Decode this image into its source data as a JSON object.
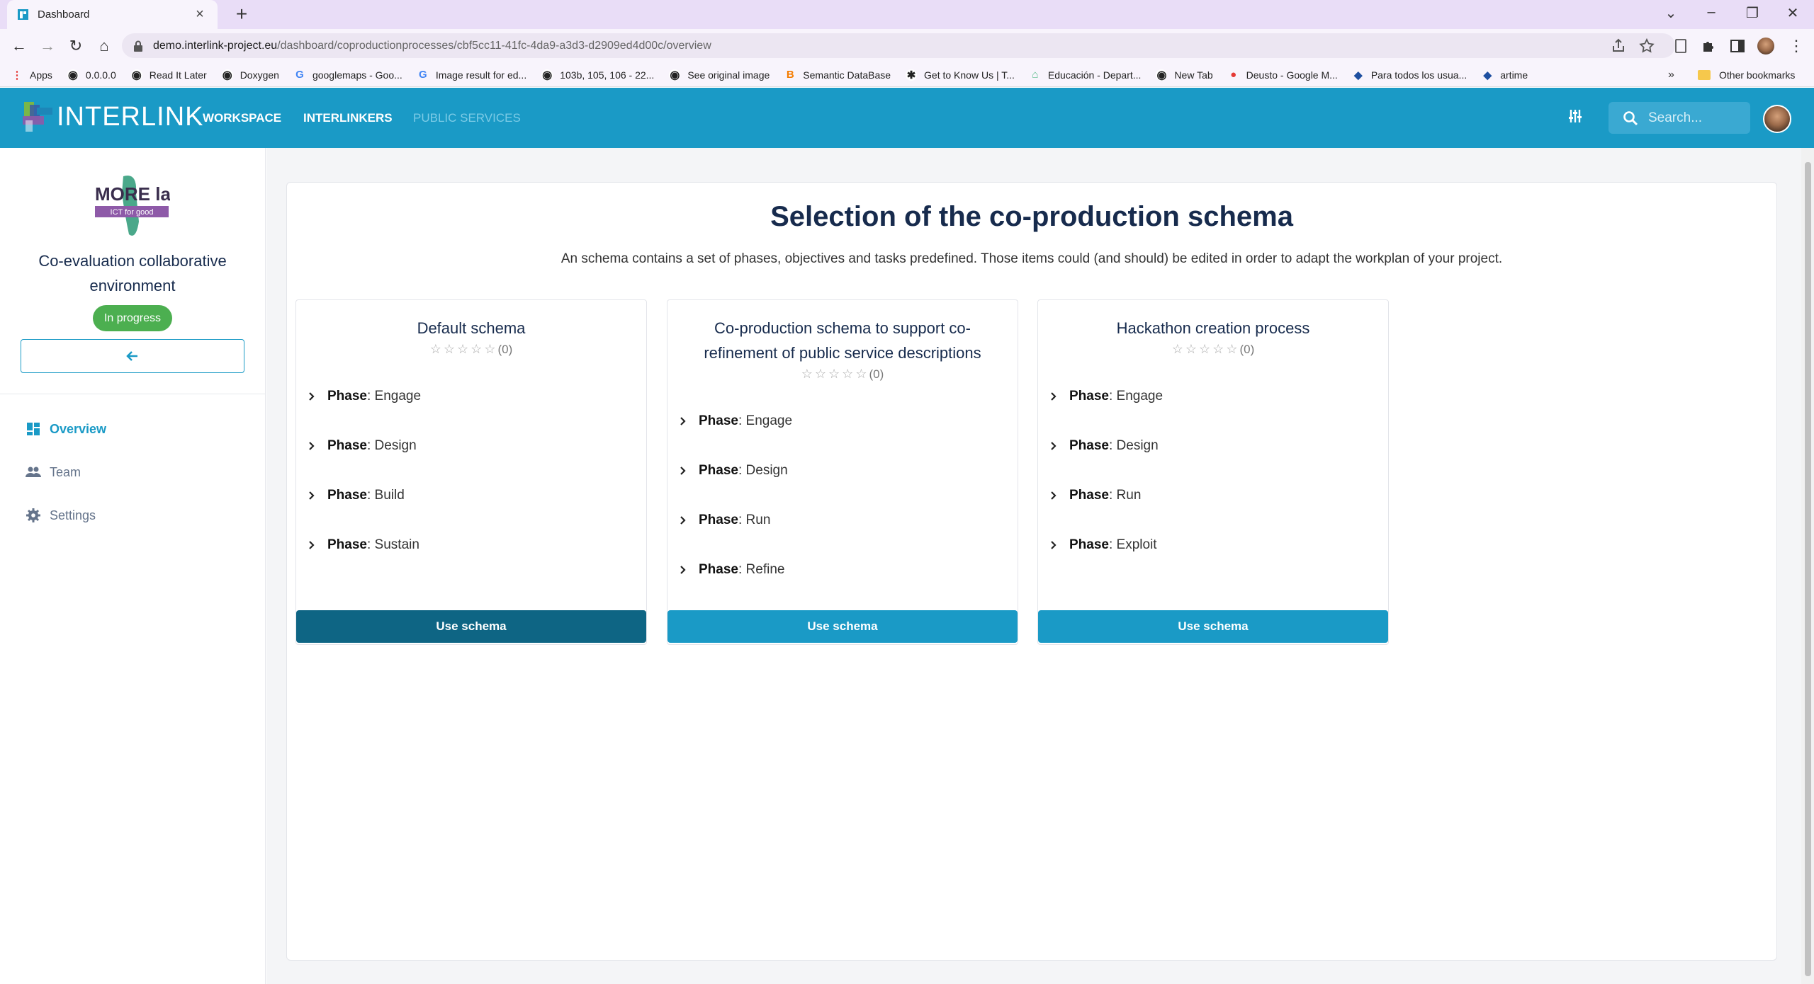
{
  "browser": {
    "tab_title": "Dashboard",
    "url_domain": "demo.interlink-project.eu",
    "url_path": "/dashboard/coproductionprocesses/cbf5cc11-41fc-4da9-a3d3-d2909ed4d00c/overview",
    "bookmarks": [
      {
        "label": "Apps",
        "icon": "apps-grid-icon",
        "color": "#e53935"
      },
      {
        "label": "0.0.0.0",
        "icon": "globe-icon",
        "color": "#222"
      },
      {
        "label": "Read It Later",
        "icon": "globe-icon",
        "color": "#222"
      },
      {
        "label": "Doxygen",
        "icon": "globe-icon",
        "color": "#222"
      },
      {
        "label": "googlemaps - Goo...",
        "icon": "google-icon",
        "color": "#4285f4"
      },
      {
        "label": "Image result for ed...",
        "icon": "google-icon",
        "color": "#4285f4"
      },
      {
        "label": "103b, 105, 106 - 22...",
        "icon": "globe-icon",
        "color": "#222"
      },
      {
        "label": "See original image",
        "icon": "globe-icon",
        "color": "#222"
      },
      {
        "label": "Semantic DataBase",
        "icon": "blogger-icon",
        "color": "#f57c00"
      },
      {
        "label": "Get to Know Us | T...",
        "icon": "star-logo-icon",
        "color": "#222"
      },
      {
        "label": "Educación - Depart...",
        "icon": "edu-icon",
        "color": "#5b8"
      },
      {
        "label": "New Tab",
        "icon": "globe-icon",
        "color": "#222"
      },
      {
        "label": "Deusto - Google M...",
        "icon": "maps-pin-icon",
        "color": "#e53935"
      },
      {
        "label": "Para todos los usua...",
        "icon": "shield-icon",
        "color": "#1e4fa0"
      },
      {
        "label": "artime",
        "icon": "shield-icon",
        "color": "#1e4fa0"
      }
    ],
    "bookmarks_more": "»",
    "other_bookmarks": "Other bookmarks"
  },
  "app": {
    "logo_text": "INTERLINK",
    "nav": {
      "workspace": "WORKSPACE",
      "interlinkers": "INTERLINKERS",
      "public_services": "PUBLIC SERVICES"
    },
    "search_placeholder": "Search..."
  },
  "sidebar": {
    "project_title": "Co-evaluation collaborative environment",
    "logo_text_main": "MORE lab",
    "logo_text_sub": "ICT for good",
    "status": "In progress",
    "items": [
      {
        "label": "Overview",
        "icon": "dashboard-icon",
        "active": true
      },
      {
        "label": "Team",
        "icon": "people-icon",
        "active": false
      },
      {
        "label": "Settings",
        "icon": "gear-icon",
        "active": false
      }
    ]
  },
  "main": {
    "title": "Selection of the co-production schema",
    "subtitle": "An schema contains a set of phases, objectives and tasks predefined. Those items could (and should) be edited in order to adapt the workplan of your project.",
    "phase_label": "Phase",
    "stars": "☆☆☆☆☆",
    "schemas": [
      {
        "title": "Default schema",
        "rating": "(0)",
        "phases": [
          "Engage",
          "Design",
          "Build",
          "Sustain"
        ],
        "button": "Use schema",
        "button_color": "#0e6584"
      },
      {
        "title": "Co-production schema to support co-refinement of public service descriptions",
        "rating": "(0)",
        "phases": [
          "Engage",
          "Design",
          "Run",
          "Refine"
        ],
        "button": "Use schema",
        "button_color": "#1a9ac6"
      },
      {
        "title": "Hackathon creation process",
        "rating": "(0)",
        "phases": [
          "Engage",
          "Design",
          "Run",
          "Exploit"
        ],
        "button": "Use schema",
        "button_color": "#1a9ac6"
      }
    ]
  },
  "colors": {
    "primary": "#1a9ac6",
    "primary_dark": "#0e6584",
    "status_green": "#4caf50"
  }
}
